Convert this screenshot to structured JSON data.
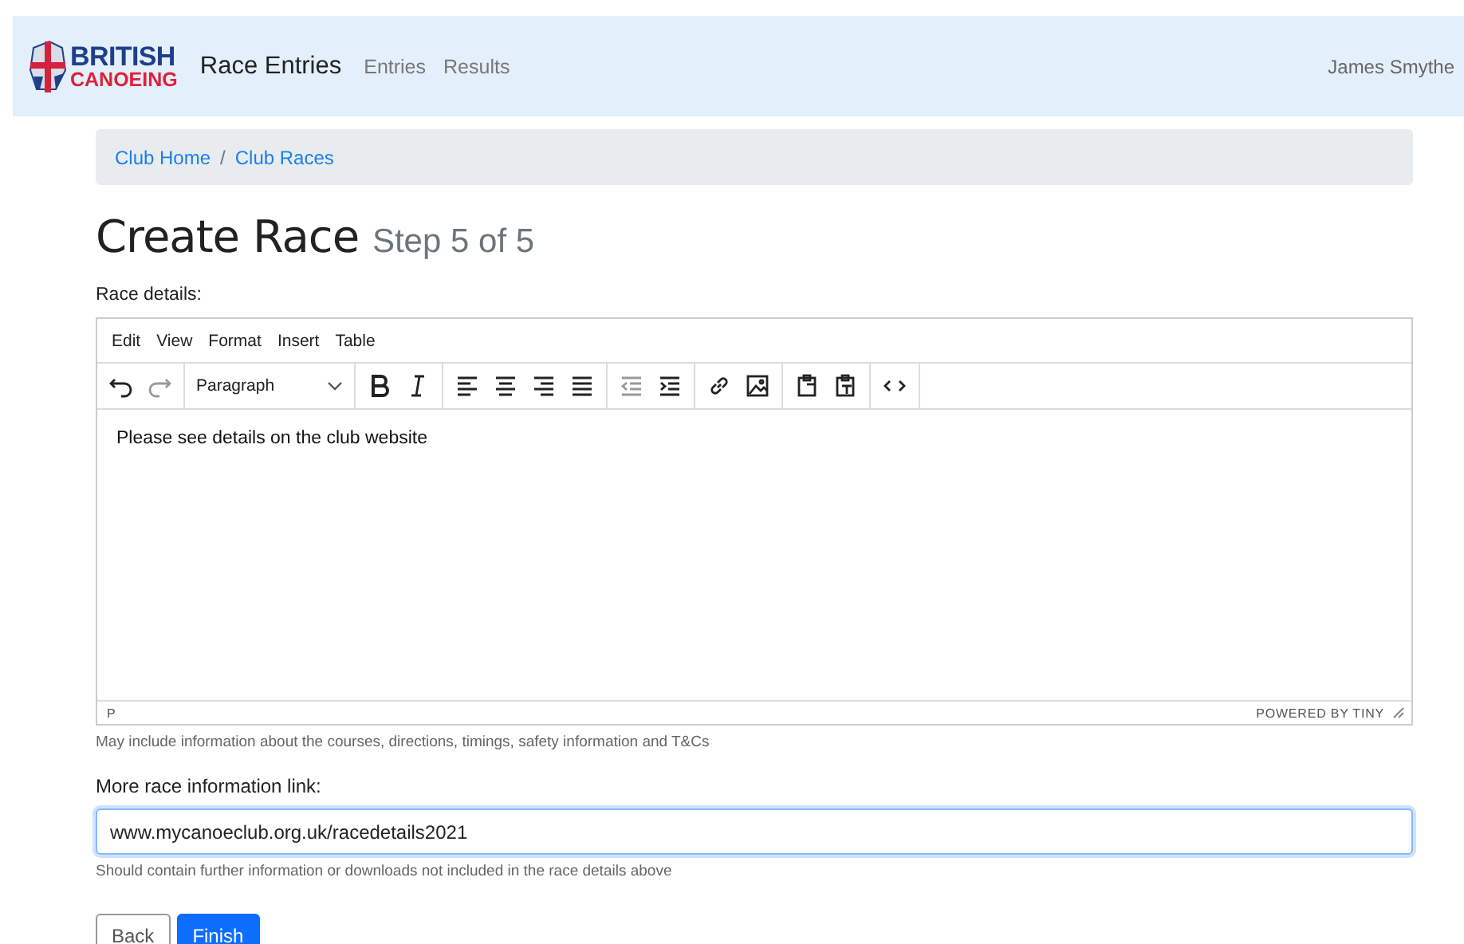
{
  "navbar": {
    "logo_top": "BRITISH",
    "logo_bottom": "CANOEING",
    "brand": "Race Entries",
    "links": [
      {
        "label": "Entries"
      },
      {
        "label": "Results"
      }
    ],
    "user": "James Smythe"
  },
  "breadcrumb": [
    {
      "label": "Club Home"
    },
    {
      "label": "Club Races"
    }
  ],
  "breadcrumb_separator": "/",
  "heading": {
    "title": "Create Race",
    "step": "Step 5 of 5"
  },
  "details": {
    "label": "Race details:",
    "menu": [
      {
        "label": "Edit"
      },
      {
        "label": "View"
      },
      {
        "label": "Format"
      },
      {
        "label": "Insert"
      },
      {
        "label": "Table"
      }
    ],
    "block_format": "Paragraph",
    "content": "Please see details on the club website",
    "path": "P",
    "branding": "POWERED BY TINY",
    "help": "May include information about the courses, directions, timings, safety information and T&Cs"
  },
  "link": {
    "label": "More race information link:",
    "value": "www.mycanoeclub.org.uk/racedetails2021",
    "focused": true,
    "help": "Should contain further information or downloads not included in the race details above"
  },
  "buttons": [
    {
      "label": "Back",
      "kind": "secondary"
    },
    {
      "label": "Finish",
      "kind": "primary"
    }
  ]
}
